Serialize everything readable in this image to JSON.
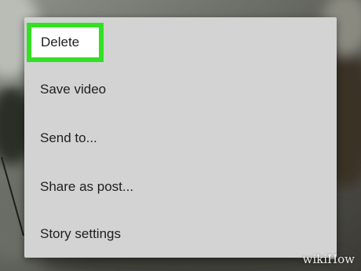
{
  "menu": {
    "items": [
      {
        "label": "Delete"
      },
      {
        "label": "Save video"
      },
      {
        "label": "Send to..."
      },
      {
        "label": "Share as post..."
      },
      {
        "label": "Story settings"
      }
    ]
  },
  "highlight_color": "#33e023",
  "watermark": "wikiHow"
}
